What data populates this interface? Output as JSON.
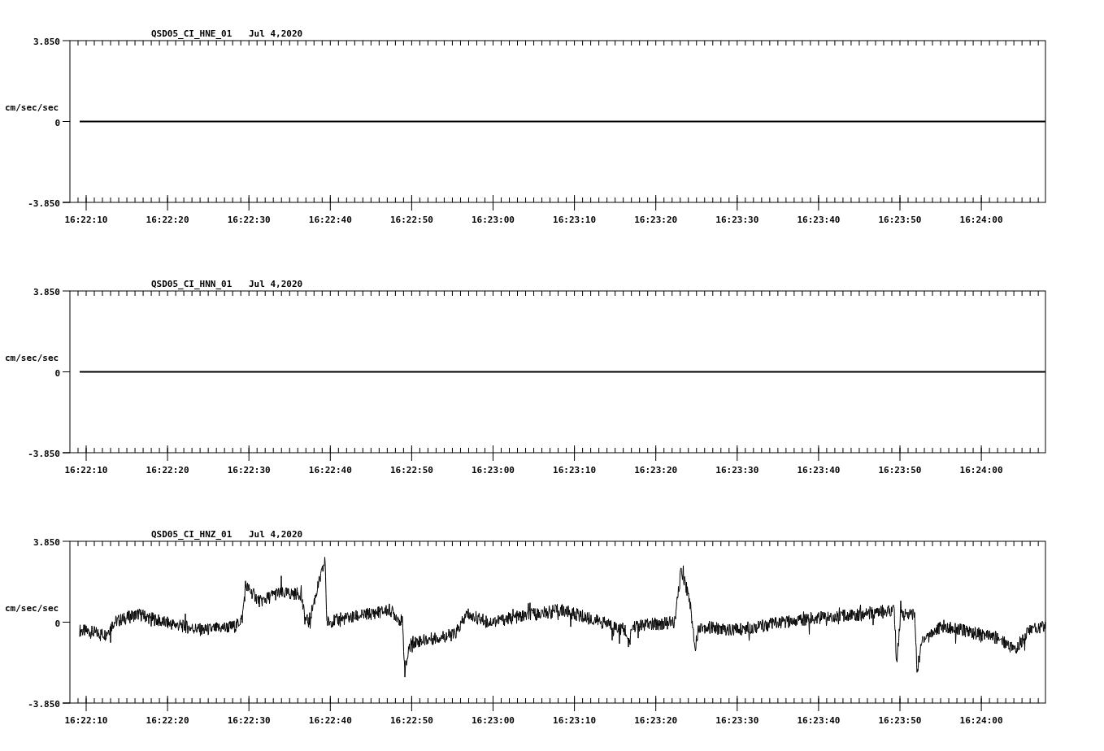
{
  "panels": [
    {
      "station": "QSD05_CI_HNE_01",
      "date": "Jul 4,2020",
      "ylabel": "cm/sec/sec",
      "yticks": [
        "3.850",
        "0",
        "-3.850"
      ],
      "xticks": [
        "16:22:10",
        "16:22:20",
        "16:22:30",
        "16:22:40",
        "16:22:50",
        "16:23:00",
        "16:23:10",
        "16:23:20",
        "16:23:30",
        "16:23:40",
        "16:23:50",
        "16:24:00"
      ],
      "kind": "flat"
    },
    {
      "station": "QSD05_CI_HNN_01",
      "date": "Jul 4,2020",
      "ylabel": "cm/sec/sec",
      "yticks": [
        "3.850",
        "0",
        "-3.850"
      ],
      "xticks": [
        "16:22:10",
        "16:22:20",
        "16:22:30",
        "16:22:40",
        "16:22:50",
        "16:23:00",
        "16:23:10",
        "16:23:20",
        "16:23:30",
        "16:23:40",
        "16:23:50",
        "16:24:00"
      ],
      "kind": "flat"
    },
    {
      "station": "QSD05_CI_HNZ_01",
      "date": "Jul 4,2020",
      "ylabel": "cm/sec/sec",
      "yticks": [
        "3.850",
        "0",
        "-3.850"
      ],
      "xticks": [
        "16:22:10",
        "16:22:20",
        "16:22:30",
        "16:22:40",
        "16:22:50",
        "16:23:00",
        "16:23:10",
        "16:23:20",
        "16:23:30",
        "16:23:40",
        "16:23:50",
        "16:24:00"
      ],
      "kind": "wave"
    }
  ]
}
